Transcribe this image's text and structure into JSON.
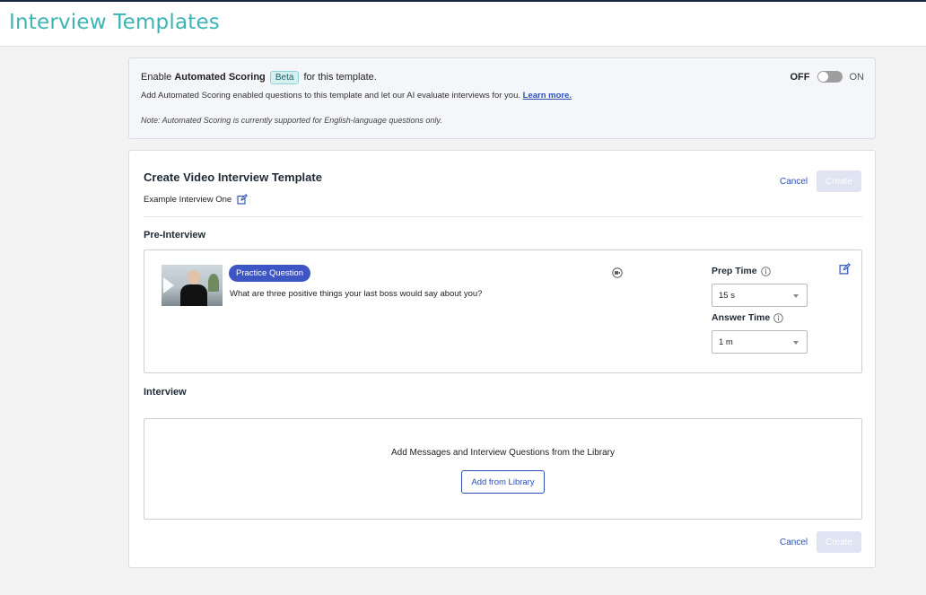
{
  "header": {
    "title": "Interview Templates"
  },
  "scoring": {
    "prefix": "Enable",
    "bold": "Automated Scoring",
    "beta": "Beta",
    "suffix": "for this template.",
    "description": "Add Automated Scoring enabled questions to this template and let our AI evaluate interviews for you.",
    "learn_more": "Learn more.",
    "note": "Note: Automated Scoring is currently supported for English-language questions only.",
    "toggle_off": "OFF",
    "toggle_on": "ON",
    "toggle_state": "off"
  },
  "card": {
    "title": "Create Video Interview Template",
    "subtitle": "Example Interview One",
    "cancel": "Cancel",
    "create": "Create",
    "pre_interview_heading": "Pre-Interview",
    "interview_heading": "Interview"
  },
  "question": {
    "badge": "Practice Question",
    "text": "What are three positive things your last boss would say about you?",
    "prep_label": "Prep Time",
    "prep_value": "15 s",
    "answer_label": "Answer Time",
    "answer_value": "1 m"
  },
  "library": {
    "text": "Add Messages and Interview Questions from the Library",
    "button": "Add from Library"
  },
  "colors": {
    "accent_teal": "#3cb4b4",
    "primary_blue": "#3d56c4",
    "link_blue": "#2b4fb5",
    "disabled_button": "#dfe3f2"
  }
}
